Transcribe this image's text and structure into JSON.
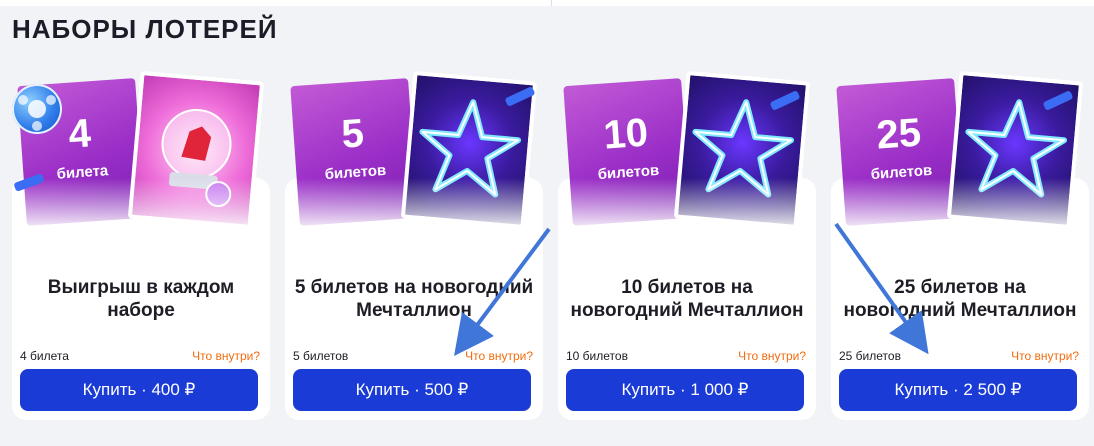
{
  "section": {
    "title": "НАБОРЫ ЛОТЕРЕЙ"
  },
  "cards": [
    {
      "ticket_number": "4",
      "ticket_word": "билета",
      "title": "Выигрыш в каждом наборе",
      "count": "4 билета",
      "inside_link": "Что внутри?",
      "button": "Купить · 400 ₽"
    },
    {
      "ticket_number": "5",
      "ticket_word": "билетов",
      "title": "5 билетов на новогодний Мечталлион",
      "count": "5 билетов",
      "inside_link": "Что внутри?",
      "button": "Купить · 500 ₽"
    },
    {
      "ticket_number": "10",
      "ticket_word": "билетов",
      "title": "10 билетов на новогодний Мечталлион",
      "count": "10 билетов",
      "inside_link": "Что внутри?",
      "button": "Купить · 1 000 ₽"
    },
    {
      "ticket_number": "25",
      "ticket_word": "билетов",
      "title": "25 билетов на новогодний Мечталлион",
      "count": "25 билетов",
      "inside_link": "Что внутри?",
      "button": "Купить · 2 500 ₽"
    }
  ],
  "colors": {
    "button": "#1a3bd6",
    "link": "#f26d10",
    "annotation_arrow": "#3f76d8"
  },
  "icons": [
    "ball-icon",
    "star-icon",
    "snow-globe-icon",
    "arrow-annotation"
  ]
}
